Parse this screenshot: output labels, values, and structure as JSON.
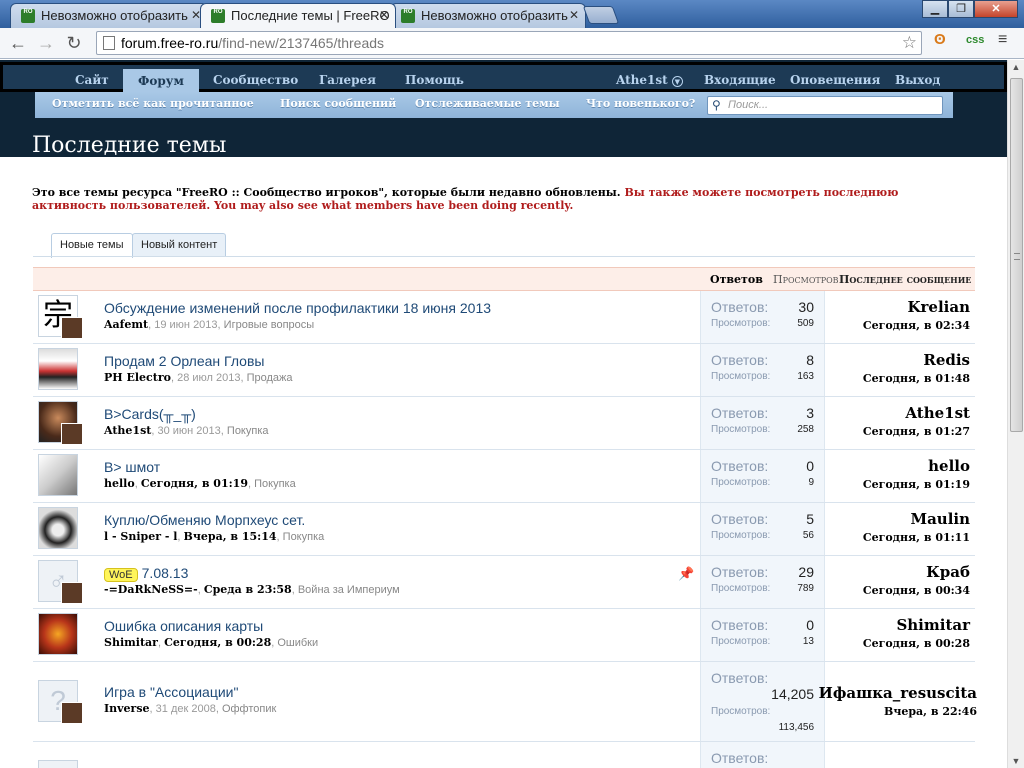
{
  "browser": {
    "tabs": [
      {
        "title": "Невозможно отобразить"
      },
      {
        "title": "Последние темы | FreeRO"
      },
      {
        "title": "Невозможно отобразить"
      }
    ],
    "favicon_text": "RO",
    "address_host": "forum.free-ro.ru",
    "address_path": "/find-new/2137465/threads",
    "ext_css": "css"
  },
  "nav": {
    "tabs": [
      "Сайт",
      "Форум",
      "Сообщество",
      "Галерея",
      "Помощь"
    ],
    "user": "Athe1st",
    "right": [
      "Входящие",
      "Оповещения",
      "Выход"
    ]
  },
  "subnav": {
    "links": [
      "Отметить всё как прочитанное",
      "Поиск сообщений",
      "Отслеживаемые темы",
      "Что новенького?"
    ],
    "search_placeholder": "Поиск..."
  },
  "page": {
    "title": "Последние темы",
    "intro_black": "Это все темы ресурса \"FreeRO :: Сообщество игроков\", которые были недавно обновлены.",
    "intro_red": "Вы также можете посмотреть последнюю активность пользователей. You may also see what members have been doing recently.",
    "content_tabs": [
      "Новые темы",
      "Новый контент"
    ]
  },
  "list_header": {
    "replies": "Ответов",
    "views": "Просмотров",
    "last": "Последнее сообщение"
  },
  "labels": {
    "replies": "Ответов:",
    "views": "Просмотров:"
  },
  "threads": [
    {
      "title": "Обсуждение изменений после профилактики 18 июня 2013",
      "prefix": "",
      "author": "Aafemt",
      "date": "19 июн 2013",
      "forum": "Игровые вопросы",
      "replies": "30",
      "views": "509",
      "last_user": "Krelian",
      "last_time": "Сегодня, в 02:34"
    },
    {
      "title": "Продам 2 Орлеан Гловы",
      "prefix": "",
      "author": "PH Electro",
      "date": "28 июл 2013",
      "forum": "Продажа",
      "replies": "8",
      "views": "163",
      "last_user": "Redis",
      "last_time": "Сегодня, в 01:48"
    },
    {
      "title": "В>Cards(╥_╥)",
      "prefix": "",
      "author": "Athe1st",
      "date": "30 июн 2013",
      "forum": "Покупка",
      "replies": "3",
      "views": "258",
      "last_user": "Athe1st",
      "last_time": "Сегодня, в 01:27"
    },
    {
      "title": "В> шмот",
      "prefix": "",
      "author": "hello",
      "date": "Сегодня, в 01:19",
      "forum": "Покупка",
      "replies": "0",
      "views": "9",
      "last_user": "hello",
      "last_time": "Сегодня, в 01:19"
    },
    {
      "title": "Куплю/Обменяю Морпхеус сет.",
      "prefix": "",
      "author": "l - Sniper - l",
      "date": "Вчера, в 15:14",
      "forum": "Покупка",
      "replies": "5",
      "views": "56",
      "last_user": "Maulin",
      "last_time": "Сегодня, в 01:11"
    },
    {
      "title": "7.08.13",
      "prefix": "WoE",
      "author": "-=DaRkNeSS=-",
      "date": "Среда в 23:58",
      "forum": "Война за Империум",
      "replies": "29",
      "views": "789",
      "last_user": "Краб",
      "last_time": "Сегодня, в 00:34"
    },
    {
      "title": "Ошибка описания карты",
      "prefix": "",
      "author": "Shimitar",
      "date": "Сегодня, в 00:28",
      "forum": "Ошибки",
      "replies": "0",
      "views": "13",
      "last_user": "Shimitar",
      "last_time": "Сегодня, в 00:28"
    },
    {
      "title": "Игра в \"Ассоциации\"",
      "prefix": "",
      "author": "Inverse",
      "date": "31 дек 2008",
      "forum": "Оффтопик",
      "replies": "14,205",
      "views": "113,456",
      "last_user": "Ифашка_resuscita",
      "last_time": "Вчера, в 22:46"
    }
  ],
  "colors": {
    "header_dark": "#0f2537",
    "nav_blue": "#1d3a55",
    "subnav_blue": "#a9c8e6",
    "link_blue": "#1f4a77",
    "intro_red": "#b01c1c",
    "list_header_bg": "#fdeee8",
    "stats_bg": "#f1f6fb",
    "woe_prefix": "#fff55a"
  }
}
